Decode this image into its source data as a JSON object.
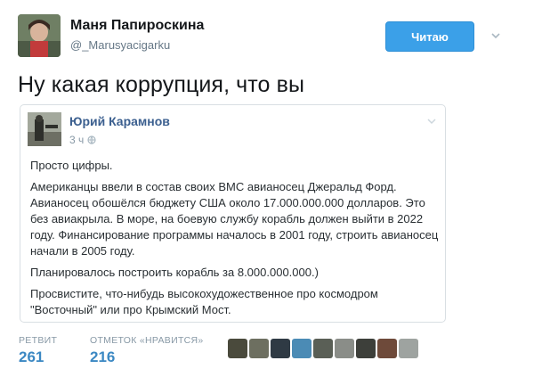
{
  "author": {
    "name": "Маня Папироскина",
    "handle": "@_Marusyacigarku"
  },
  "follow_button": {
    "label": "Читаю"
  },
  "tweet": {
    "text": "Ну какая коррупция, что вы"
  },
  "quoted": {
    "author_name": "Юрий Карамнов",
    "time": "3 ч",
    "paragraphs": [
      "Просто цифры.",
      "Американцы ввели в состав своих ВМС авианосец Джеральд Форд. Авианосец обошёлся бюджету США около 17.000.000.000 долларов. Это без авиакрыла. В море, на боевую службу корабль должен выйти в 2022 году. Финансирование программы началось в 2001 году, строить авианосец начали в 2005 году.",
      "Планировалось построить корабль за 8.000.000.000.)",
      "Просвистите, что-нибудь высокохудожественное про космодром \"Восточный\" или про Крымский Мост."
    ]
  },
  "stats": {
    "retweets": {
      "label": "РЕТВИТ",
      "value": "261"
    },
    "likes": {
      "label": "ОТМЕТОК «НРАВИТСЯ»",
      "value": "216"
    }
  },
  "likers": [
    {
      "name": "liker-1",
      "color": "#4a4a3c"
    },
    {
      "name": "liker-2",
      "color": "#6d6f60"
    },
    {
      "name": "liker-3",
      "color": "#2f3a44"
    },
    {
      "name": "liker-4",
      "color": "#4b8bb5"
    },
    {
      "name": "liker-5",
      "color": "#5a5f56"
    },
    {
      "name": "liker-6",
      "color": "#8a8d88"
    },
    {
      "name": "liker-7",
      "color": "#3d3f3a"
    },
    {
      "name": "liker-8",
      "color": "#6e4a3a"
    },
    {
      "name": "liker-9",
      "color": "#9ea3a0"
    }
  ]
}
